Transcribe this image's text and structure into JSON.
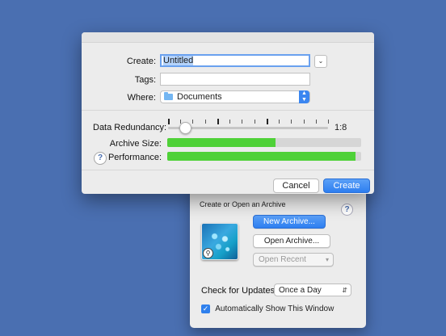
{
  "launcher": {
    "heading": "Create or Open an Archive",
    "help": "?",
    "new_archive": "New Archive...",
    "open_archive": "Open Archive...",
    "open_recent": "Open Recent",
    "check_updates_label": "Check for Updates",
    "update_frequency": "Once a Day",
    "auto_show_label": "Automatically Show This Window",
    "auto_show_checked": true
  },
  "dialog": {
    "create_label": "Create:",
    "create_value": "Untitled",
    "tags_label": "Tags:",
    "tags_value": "",
    "where_label": "Where:",
    "where_value": "Documents",
    "redundancy_label": "Data Redundancy:",
    "redundancy_ratio": "1:8",
    "redundancy_slider_fraction": 0.1,
    "archive_size_label": "Archive Size:",
    "archive_size_fraction": 0.56,
    "performance_label": "Performance:",
    "performance_fraction": 0.97,
    "help": "?",
    "cancel": "Cancel",
    "create": "Create"
  },
  "colors": {
    "desktop": "#4a6fb1",
    "accent": "#2d7ef0",
    "bar_fill": "#4fd138"
  }
}
